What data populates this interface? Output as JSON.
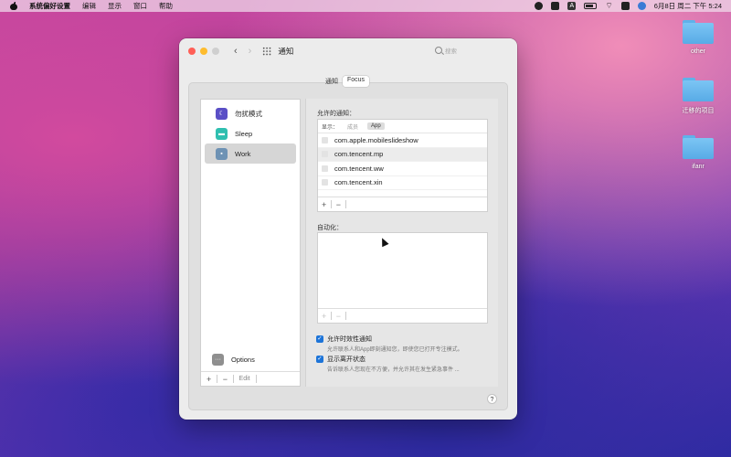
{
  "menubar": {
    "app_name": "系统偏好设置",
    "menus": [
      "编辑",
      "显示",
      "窗口",
      "帮助"
    ],
    "input_method": "A",
    "datetime": "6月8日 周二 下午 5:24"
  },
  "desktop": {
    "folders": [
      {
        "label": "other"
      },
      {
        "label": "迁移的项目"
      },
      {
        "label": "ifanr"
      }
    ]
  },
  "window": {
    "title": "通知",
    "search_placeholder": "搜索",
    "tabs": [
      {
        "label": "通知",
        "active": false
      },
      {
        "label": "Focus",
        "active": true
      }
    ]
  },
  "focus_list": {
    "items": [
      {
        "label": "勿扰模式",
        "icon": "moon-icon"
      },
      {
        "label": "Sleep",
        "icon": "bed-icon"
      },
      {
        "label": "Work",
        "icon": "badge-icon",
        "selected": true
      }
    ],
    "options_label": "Options",
    "add_label": "+",
    "remove_label": "−",
    "edit_label": "Edit"
  },
  "allowed": {
    "heading": "允许的通知：",
    "filter_label": "显示：",
    "filters": [
      "成员",
      "App"
    ],
    "selected_filter": "App",
    "apps": [
      "com.apple.mobileslideshow",
      "com.tencent.mp",
      "com.tencent.ww",
      "com.tencent.xin"
    ],
    "add_label": "+",
    "remove_label": "−"
  },
  "automation": {
    "heading": "自动化：",
    "add_label": "+",
    "remove_label": "−"
  },
  "options": {
    "time_sensitive": {
      "checked": true,
      "label": "允许时效性通知",
      "desc": "允许联系人和App即刻通知您，即使您已打开专注模式。"
    },
    "share_status": {
      "checked": true,
      "label": "显示离开状态",
      "desc": "告诉联系人您现在不方便，并允许其在发生紧急事件 ..."
    }
  },
  "help_label": "?",
  "colors": {
    "accent": "#1d74d8",
    "close": "#ff5f57",
    "minimize": "#febc2e"
  }
}
